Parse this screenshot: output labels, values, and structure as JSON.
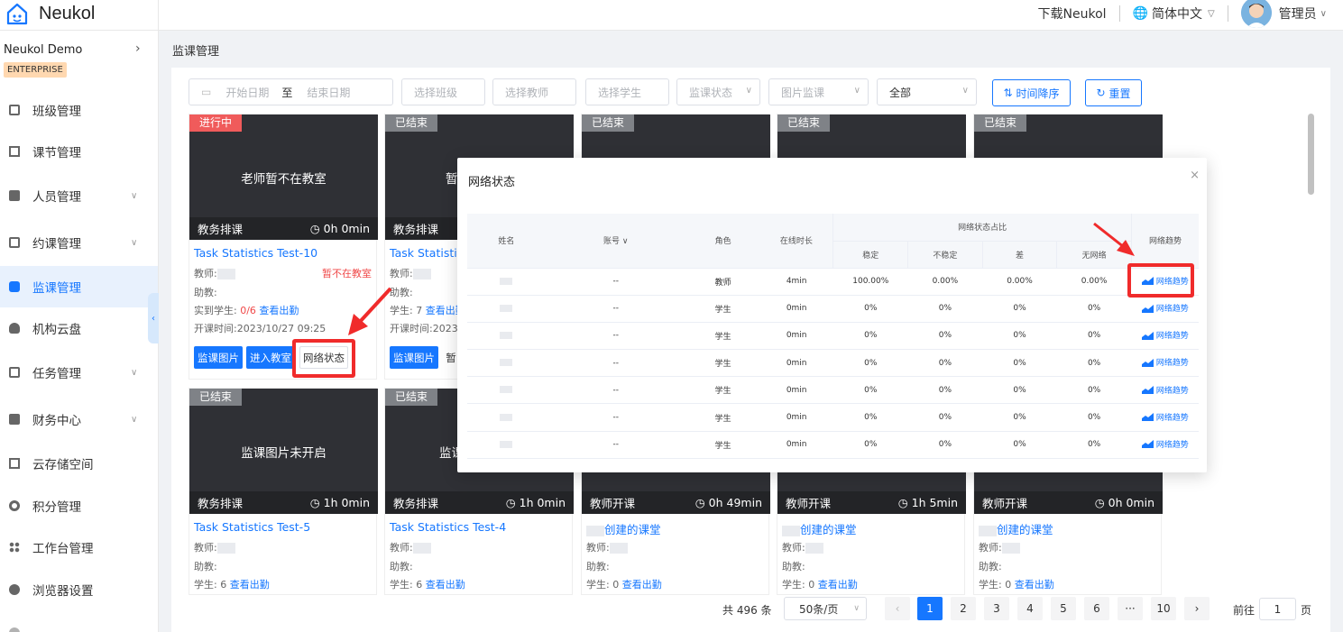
{
  "app": {
    "name": "Neukol",
    "download": "下载Neukol",
    "language": "简体中文",
    "user": "管理员"
  },
  "sidebar": {
    "org": "Neukol Demo",
    "badge": "ENTERPRISE",
    "items": [
      {
        "label": "班级管理"
      },
      {
        "label": "课节管理"
      },
      {
        "label": "人员管理"
      },
      {
        "label": "约课管理"
      },
      {
        "label": "监课管理"
      },
      {
        "label": "机构云盘"
      },
      {
        "label": "任务管理"
      },
      {
        "label": "财务中心"
      },
      {
        "label": "云存储空间"
      },
      {
        "label": "积分管理"
      },
      {
        "label": "工作台管理"
      },
      {
        "label": "浏览器设置"
      }
    ]
  },
  "breadcrumb": "监课管理",
  "filters": {
    "start_date": "开始日期",
    "to": "至",
    "end_date": "结束日期",
    "class": "选择班级",
    "teacher": "选择教师",
    "student": "选择学生",
    "status": "监课状态",
    "image": "图片监课",
    "all": "全部",
    "sort": "时间降序",
    "reset": "重置"
  },
  "cards": [
    {
      "tag": "进行中",
      "msg": "老师暂不在教室",
      "type": "教务排课",
      "time": "0h 0min",
      "title": "Task Statistics Test-10",
      "teacher": "教师:",
      "teacher_status": "暂不在教室",
      "assist": "助教:",
      "students_prefix": "实到学生: ",
      "students_count": "0/6",
      "attendance": "查看出勤",
      "start": "开课时间:2023/10/27 09:25",
      "btn1": "监课图片",
      "btn2": "进入教室",
      "btn3": "网络状态"
    },
    {
      "tag": "已结束",
      "msg": "暂",
      "type": "教务排课",
      "title": "Task Statisti",
      "teacher": "教师:",
      "assist": "助教:",
      "students_prefix": "学生: 7 ",
      "attendance": "查看出勤",
      "start": "开课时间:2023,",
      "btn1": "监课图片",
      "btn2": "暂"
    },
    {
      "tag": "已结束"
    },
    {
      "tag": "已结束"
    },
    {
      "tag": "已结束"
    },
    {
      "tag": "已结束",
      "msg": "监课图片未开启",
      "type": "教务排课",
      "time": "1h 0min",
      "title": "Task Statistics Test-5",
      "teacher": "教师:",
      "assist": "助教:",
      "students_prefix": "学生: 6 ",
      "attendance": "查看出勤"
    },
    {
      "tag": "已结束",
      "msg": "监课",
      "type": "教务排课",
      "time": "1h 0min",
      "title": "Task Statistics Test-4",
      "teacher": "教师:",
      "assist": "助教:",
      "students_prefix": "学生: 6 ",
      "attendance": "查看出勤"
    },
    {
      "type": "教师开课",
      "time": "0h 49min",
      "title": "创建的课堂",
      "teacher": "教师:",
      "assist": "助教:",
      "students_prefix": "学生: 0 ",
      "attendance": "查看出勤"
    },
    {
      "type": "教师开课",
      "time": "1h 5min",
      "title": "创建的课堂",
      "teacher": "教师:",
      "assist": "助教:",
      "students_prefix": "学生: 0 ",
      "attendance": "查看出勤"
    },
    {
      "type": "教师开课",
      "time": "0h 0min",
      "title": "创建的课堂",
      "teacher": "教师:",
      "assist": "助教:",
      "students_prefix": "学生: 0 ",
      "attendance": "查看出勤"
    }
  ],
  "modal": {
    "title": "网络状态",
    "close": "×",
    "headers": {
      "name": "姓名",
      "account": "账号",
      "role": "角色",
      "online": "在线时长",
      "ratio": "网络状态占比",
      "stable": "稳定",
      "unstable": "不稳定",
      "poor": "差",
      "none": "无网络",
      "trend": "网络趋势"
    },
    "rows": [
      {
        "account": "--",
        "role": "教师",
        "online": "4min",
        "stable": "100.00%",
        "unstable": "0.00%",
        "poor": "0.00%",
        "none": "0.00%",
        "trend": "网络趋势"
      },
      {
        "account": "--",
        "role": "学生",
        "online": "0min",
        "stable": "0%",
        "unstable": "0%",
        "poor": "0%",
        "none": "0%",
        "trend": "网络趋势"
      },
      {
        "account": "--",
        "role": "学生",
        "online": "0min",
        "stable": "0%",
        "unstable": "0%",
        "poor": "0%",
        "none": "0%",
        "trend": "网络趋势"
      },
      {
        "account": "--",
        "role": "学生",
        "online": "0min",
        "stable": "0%",
        "unstable": "0%",
        "poor": "0%",
        "none": "0%",
        "trend": "网络趋势"
      },
      {
        "account": "--",
        "role": "学生",
        "online": "0min",
        "stable": "0%",
        "unstable": "0%",
        "poor": "0%",
        "none": "0%",
        "trend": "网络趋势"
      },
      {
        "account": "--",
        "role": "学生",
        "online": "0min",
        "stable": "0%",
        "unstable": "0%",
        "poor": "0%",
        "none": "0%",
        "trend": "网络趋势"
      },
      {
        "account": "--",
        "role": "学生",
        "online": "0min",
        "stable": "0%",
        "unstable": "0%",
        "poor": "0%",
        "none": "0%",
        "trend": "网络趋势"
      }
    ]
  },
  "pagination": {
    "total": "共 496 条",
    "page_size": "50条/页",
    "pages": [
      "1",
      "2",
      "3",
      "4",
      "5",
      "6",
      "···",
      "10"
    ],
    "goto": "前往",
    "goto_value": "1",
    "page_unit": "页",
    "prev": "‹",
    "next": "›"
  },
  "colors": {
    "primary": "#1677ff",
    "live": "#f05b5b",
    "ended": "#7f8287",
    "highlight": "#f02b2b"
  }
}
